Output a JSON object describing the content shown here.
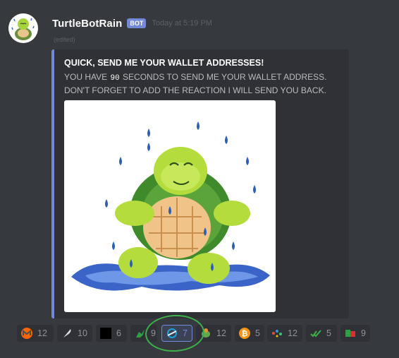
{
  "message": {
    "username": "TurtleBotRain",
    "bot_tag": "BOT",
    "timestamp": "Today at 5:19 PM",
    "edited": "(edited)"
  },
  "embed": {
    "accent_color": "#7289da",
    "title": "QUICK, SEND ME YOUR WALLET ADDRESSES!",
    "desc_before": "YOU HAVE",
    "seconds": "90",
    "desc_after": "SECONDS TO SEND ME YOUR WALLET ADDRESS. DON'T FORGET TO ADD THE REACTION I WILL SEND YOU BACK."
  },
  "reactions": [
    {
      "icon": "monero-icon",
      "count": "12"
    },
    {
      "icon": "feather-icon",
      "count": "10"
    },
    {
      "icon": "black-square-icon",
      "count": "6"
    },
    {
      "icon": "dragon-icon",
      "count": "9"
    },
    {
      "icon": "stellar-icon",
      "count": "7",
      "active": true
    },
    {
      "icon": "turtle-coin-icon",
      "count": "12"
    },
    {
      "icon": "bitcoin-icon",
      "count": "5"
    },
    {
      "icon": "colorful-dots-icon",
      "count": "12"
    },
    {
      "icon": "green-checks-icon",
      "count": "5"
    },
    {
      "icon": "green-red-icon",
      "count": "9"
    }
  ],
  "highlight_color": "#3cb049"
}
